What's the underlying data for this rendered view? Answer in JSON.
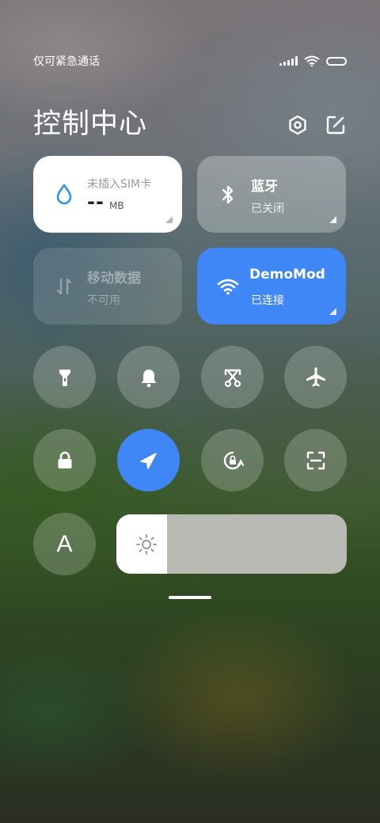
{
  "status_bar": {
    "carrier_text": "仅可紧急通话"
  },
  "header": {
    "title": "控制中心",
    "icons": [
      "settings-icon",
      "edit-icon"
    ]
  },
  "tiles": {
    "data_usage": {
      "title": "未插入SIM卡",
      "value": "--",
      "unit": "MB",
      "icon": "water-drop-icon"
    },
    "bluetooth": {
      "title": "蓝牙",
      "status": "已关闭",
      "icon": "bluetooth-icon"
    },
    "mobile_data": {
      "title": "移动数据",
      "status": "不可用",
      "icon": "data-arrows-icon"
    },
    "wifi": {
      "title": "DemoMod",
      "status": "已连接",
      "icon": "wifi-icon"
    }
  },
  "toggles": [
    "flashlight-icon",
    "bell-icon",
    "screenshot-icon",
    "airplane-icon",
    "lock-icon",
    "location-icon",
    "rotation-lock-icon",
    "scan-icon"
  ],
  "font_size": {
    "label": "A"
  },
  "brightness": {
    "icon": "sun-icon",
    "level_fraction": 0.22
  },
  "colors": {
    "accent": "#3f86f6",
    "drop": "#2b95ee"
  }
}
